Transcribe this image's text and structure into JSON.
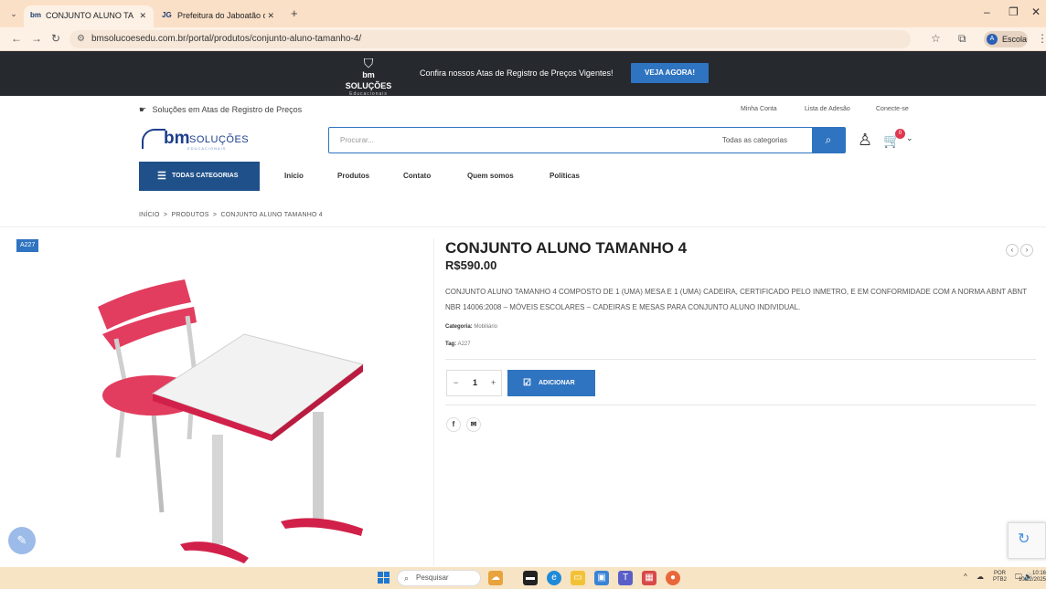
{
  "browser": {
    "tabs": [
      {
        "title": "CONJUNTO ALUNO TAMANHO",
        "favicon": "bm",
        "active": true
      },
      {
        "title": "Prefeitura do Jaboatão dos Gua",
        "favicon": "JG",
        "active": false
      }
    ],
    "url": "bmsolucoesedu.com.br/portal/produtos/conjunto-aluno-tamanho-4/",
    "profile_name": "Escola",
    "profile_initial": "A"
  },
  "promo": {
    "logo_word": "bm SOLUÇÕES",
    "logo_sub": "Educacionais",
    "text": "Confira nossos Atas de Registro de Preços Vigentes!",
    "button": "VEJA AGORA!"
  },
  "header": {
    "tagline": "Soluções em Atas de Registro de Preços",
    "top_links": [
      "Minha Conta",
      "Lista de Adesão",
      "Conecte-se"
    ],
    "logo": {
      "bm": "bm",
      "solucoes": "SOLUÇÕES",
      "edu": "EDUCACIONAIS"
    },
    "search_placeholder": "Procurar...",
    "search_category": "Todas as categorias",
    "cart_count": "0"
  },
  "nav": {
    "all_categories": "TODAS CATEGORIAS",
    "links": [
      "Início",
      "Produtos",
      "Contato",
      "Quem somos",
      "Políticas"
    ]
  },
  "breadcrumb": "INÍCIO  >  PRODUTOS  >  CONJUNTO ALUNO TAMANHO 4",
  "product": {
    "sku_badge": "A227",
    "title": "CONJUNTO ALUNO TAMANHO 4",
    "price": "R$590.00",
    "description": "CONJUNTO ALUNO TAMANHO 4 COMPOSTO DE 1 (UMA) MESA E 1 (UMA) CADEIRA, CERTIFICADO PELO INMETRO, E EM CONFORMIDADE COM A NORMA ABNT ABNT NBR 14006:2008 – MÓVEIS ESCOLARES – CADEIRAS E MESAS PARA CONJUNTO ALUNO INDIVIDUAL.",
    "category_label": "Categoria:",
    "category_value": "Mobiliário",
    "tag_label": "Tag:",
    "tag_value": "A227",
    "quantity": "1",
    "add_button": "ADICIONAR"
  },
  "taskbar": {
    "search_placeholder": "Pesquisar",
    "lang": "POR",
    "layout": "PTB2",
    "time": "10:16",
    "date": "10/12/2025"
  },
  "colors": {
    "brand_blue": "#2f74c0",
    "dark_banner": "#26292e",
    "nav_blue": "#1f5089",
    "taskbar": "#f7e4c5"
  }
}
